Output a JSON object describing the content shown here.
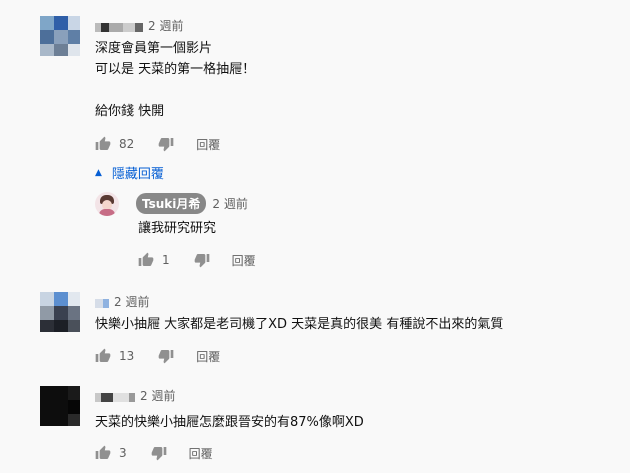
{
  "colors": {
    "background": "#f9f9f9",
    "link": "#065fd4",
    "muted": "#606060",
    "chip_bg": "#888888"
  },
  "comments": [
    {
      "author": "",
      "time": "2 週前",
      "lines": [
        "深度會員第一個影片",
        "可以是  天菜的第一格抽屜！",
        "",
        "給你錢 快開"
      ],
      "likes": "82",
      "reply_label": "回覆",
      "replies_toggle": "隱藏回覆",
      "replies": [
        {
          "author": "Tsuki月希",
          "time": "2 週前",
          "lines": [
            "讓我研究研究"
          ],
          "likes": "1",
          "reply_label": "回覆"
        }
      ]
    },
    {
      "author": "",
      "time": "2 週前",
      "lines": [
        "快樂小抽屜 大家都是老司機了XD 天菜是真的很美 有種說不出來的氣質"
      ],
      "likes": "13",
      "reply_label": "回覆"
    },
    {
      "author": "",
      "time": "2 週前",
      "lines": [
        "天菜的快樂小抽屜怎麼跟晉安的有87%像啊XD"
      ],
      "likes": "3",
      "reply_label": "回覆"
    }
  ],
  "icons": {
    "like": "thumb-up-icon",
    "dislike": "thumb-down-icon",
    "toggle": "caret-up-icon"
  }
}
